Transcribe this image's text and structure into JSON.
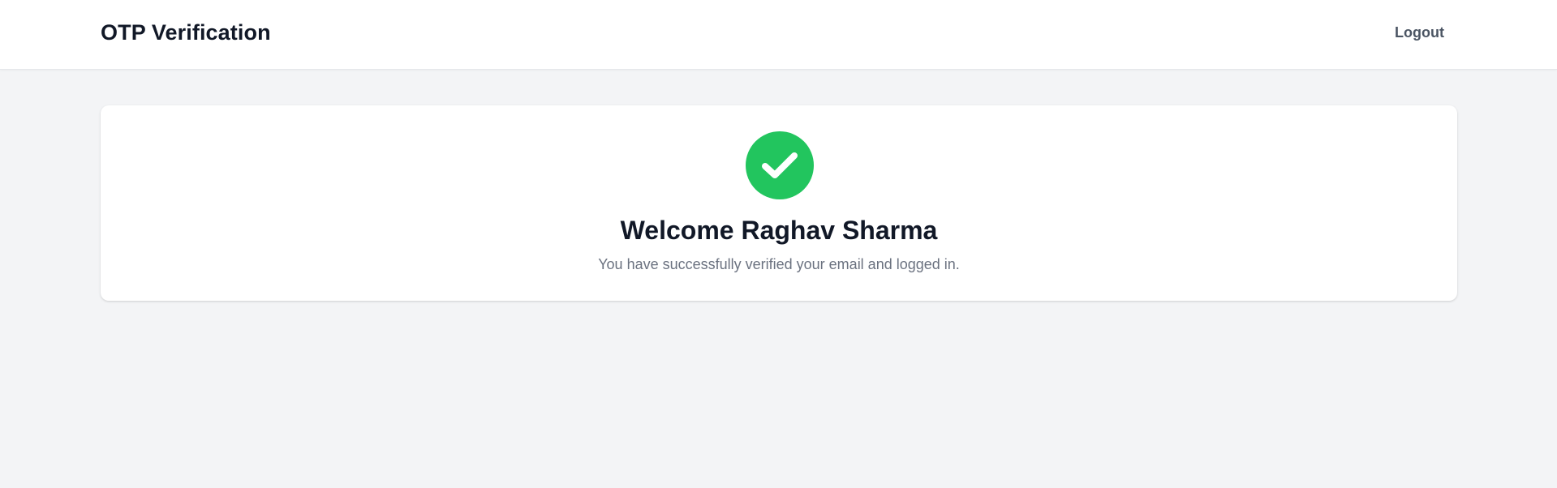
{
  "header": {
    "title": "OTP Verification",
    "logout_label": "Logout"
  },
  "main": {
    "status_icon": "check-circle-icon",
    "welcome_text": "Welcome Raghav Sharma",
    "message": "You have successfully verified your email and logged in."
  },
  "colors": {
    "success": "#22c55e",
    "background": "#f3f4f6",
    "card": "#ffffff",
    "heading": "#111827",
    "muted": "#6b7280"
  }
}
